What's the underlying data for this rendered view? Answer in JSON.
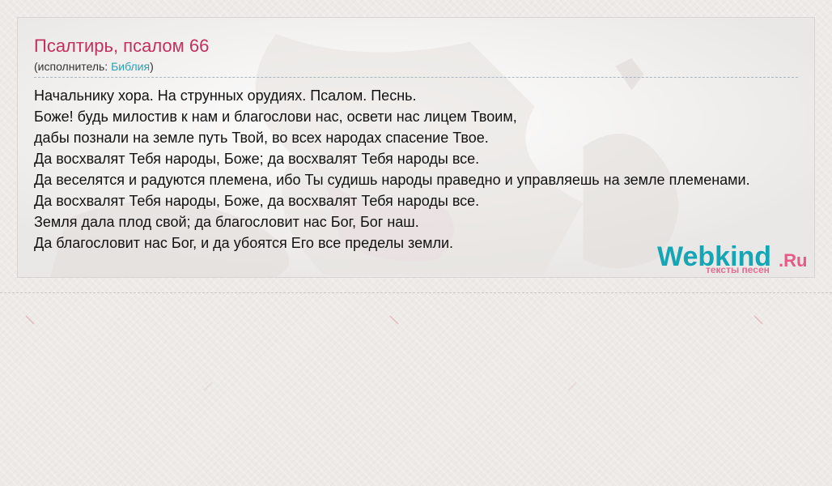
{
  "song": {
    "title": "Псалтирь, псалом 66",
    "performer_prefix": "(исполнитель: ",
    "performer_name": "Библия",
    "performer_suffix": ")"
  },
  "lyrics": [
    "Начальнику хора. На струнных орудиях. Псалом. Песнь.",
    "Боже! будь милостив к нам и благослови нас, освети нас лицем Твоим,",
    "дабы познали на земле путь Твой, во всех народах спасение Твое.",
    "Да восхвалят Тебя народы, Боже; да восхвалят Тебя народы все.",
    "Да веселятся и радуются племена, ибо Ты судишь народы праведно и управляешь на земле племенами.",
    "Да восхвалят Тебя народы, Боже, да восхвалят Тебя народы все.",
    "Земля дала плод свой; да благословит нас Бог, Бог наш.",
    "Да благословит нас Бог, и да убоятся Его все пределы земли."
  ],
  "logo": {
    "main": "Webkind",
    "tld": ".Ru",
    "subtitle": "тексты песен"
  },
  "colors": {
    "title": "#c2305f",
    "link": "#2aa1b3",
    "logo_main": "#14a6b5",
    "logo_accent": "#e85a86"
  }
}
